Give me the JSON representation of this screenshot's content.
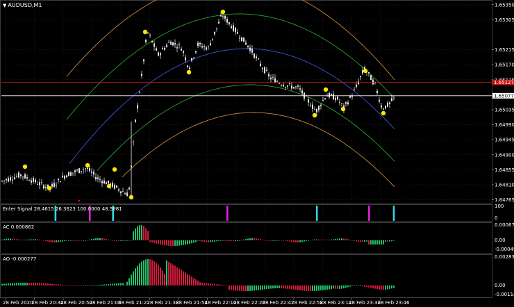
{
  "header": {
    "symbol_title": "AUDUSD,M1",
    "dropdown_icon": "triangle-down-icon"
  },
  "colors": {
    "background": "#000000",
    "grid": "#2b2b2b",
    "candle": "#ffffff",
    "marker": "#ffe600",
    "band_orange": "#c88a3c",
    "band_green": "#2ea02e",
    "band_blue": "#3a55d8",
    "hline_red": "#c81414",
    "hline_white": "#ffffff",
    "signal_cyan": "#33d6e0",
    "signal_magenta": "#e020e0",
    "ac_up": "#21c06a",
    "ac_down": "#d21a3e"
  },
  "main_panel": {
    "price_ticks": [
      "1.65350",
      "1.65305",
      "1.65215",
      "1.65170",
      "1.65125",
      "1.65035",
      "1.64990",
      "1.64945",
      "1.64900",
      "1.64855",
      "1.64810",
      "1.64765"
    ],
    "price_tick_values": [
      1.6535,
      1.65305,
      1.65215,
      1.6517,
      1.65125,
      1.65035,
      1.6499,
      1.64945,
      1.649,
      1.64855,
      1.6481,
      1.64765
    ],
    "price_min": 1.6476,
    "price_max": 1.6536,
    "red_line_label": "1.65127",
    "red_line_value": 1.65117,
    "current_price_label": "1.65077",
    "current_price_value": 1.65077
  },
  "signal_panel": {
    "label": "Enter Signal 28.4615 26.3623 100.0000 48.5981",
    "ticks": [
      "100",
      "0"
    ],
    "signals": [
      {
        "x": 0.142,
        "color": "cyan"
      },
      {
        "x": 0.232,
        "color": "magenta"
      },
      {
        "x": 0.293,
        "color": "cyan"
      },
      {
        "x": 0.593,
        "color": "magenta"
      },
      {
        "x": 0.828,
        "color": "cyan"
      },
      {
        "x": 0.965,
        "color": "magenta"
      },
      {
        "x": 1.03,
        "color": "cyan"
      }
    ]
  },
  "ac_panel": {
    "label": "AC 0.000862",
    "ticks": [
      "0.000673",
      "0.00",
      "-0.00049"
    ],
    "ymax": 0.000673,
    "ymin": -0.00049
  },
  "ao_panel": {
    "label": "AO -0.000277",
    "ticks": [
      "0.002831",
      "0.00",
      "-0.00114"
    ],
    "ymax": 0.002831,
    "ymin": -0.00114
  },
  "time_axis": [
    "28 Feb 2020",
    "28 Feb 20:34",
    "28 Feb 20:50",
    "28 Feb 21:06",
    "28 Feb 21:22",
    "28 Feb 21:38",
    "28 Feb 21:54",
    "28 Feb 22:10",
    "28 Feb 22:26",
    "28 Feb 22:42",
    "28 Feb 22:58",
    "28 Feb 23:14",
    "28 Feb 23:30",
    "28 Feb 23:46"
  ]
}
